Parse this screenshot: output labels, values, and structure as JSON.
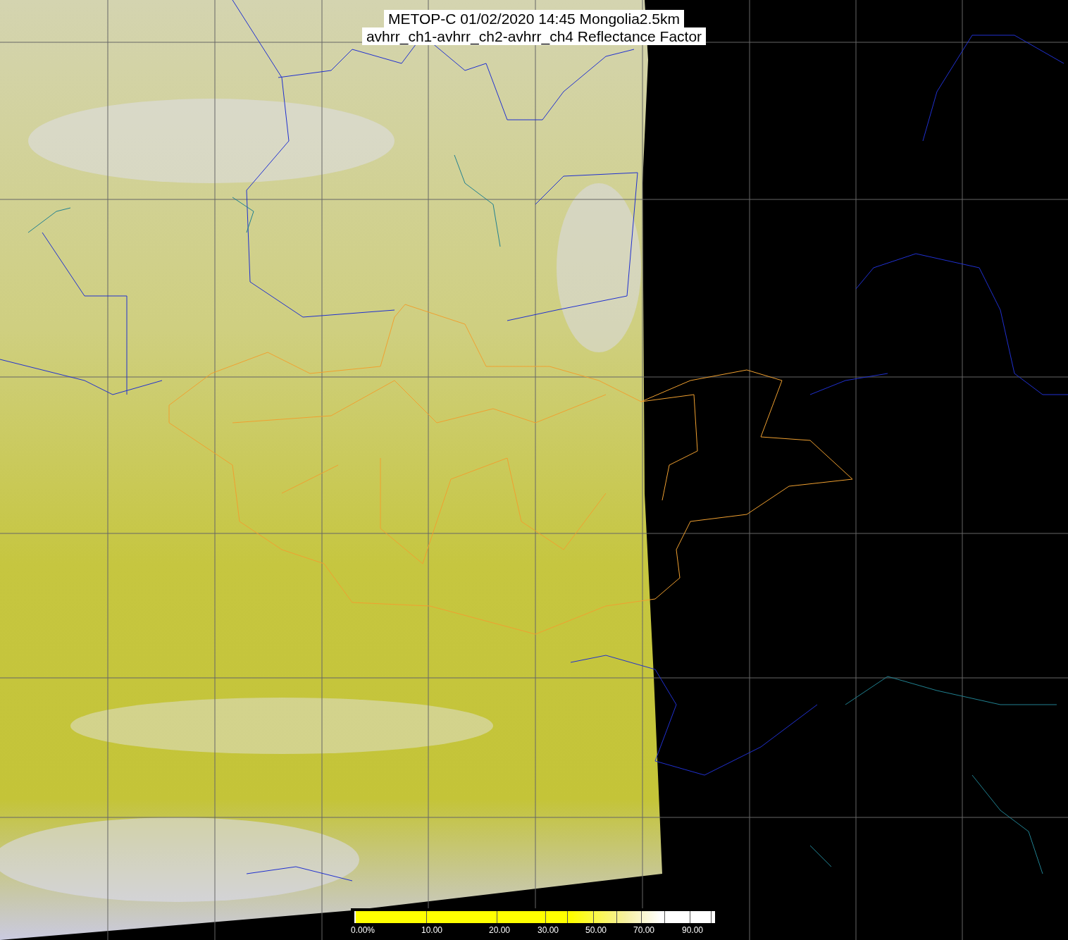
{
  "title": {
    "lines": [
      "METOP-C 01/02/2020 14:45 Mongolia2.5km",
      "avhrr_ch1-avhrr_ch2-avhrr_ch4 Reflectance Factor"
    ]
  },
  "colorbar": {
    "labels": [
      "0.00%",
      "10.00",
      "20.00",
      "30.00",
      "50.00",
      "70.00",
      "90.00"
    ]
  }
}
